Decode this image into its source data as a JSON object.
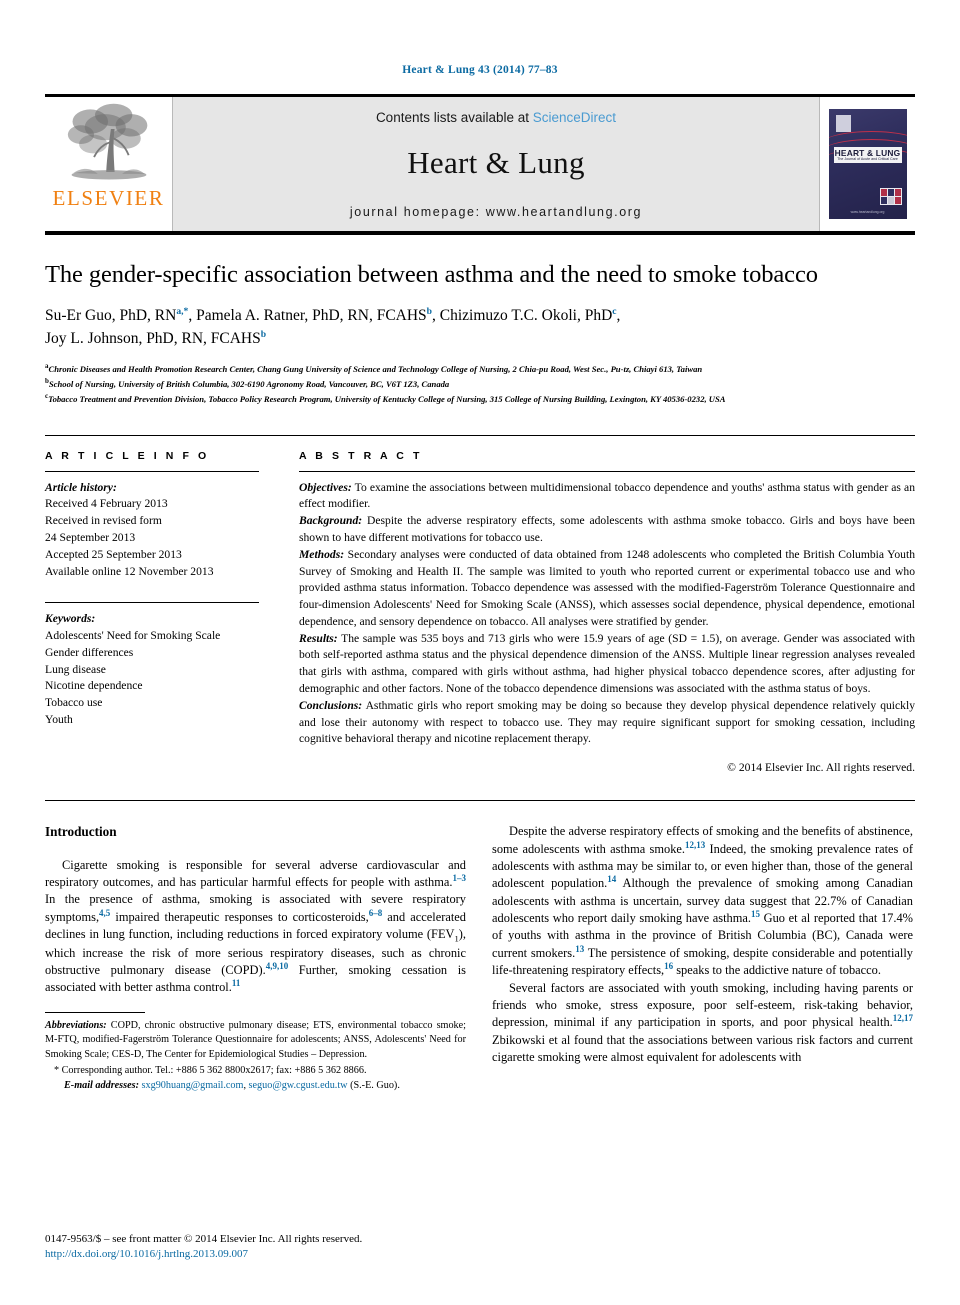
{
  "running_head": "Heart & Lung 43 (2014) 77–83",
  "masthead": {
    "contents_prefix": "Contents lists available at ",
    "sciencedirect": "ScienceDirect",
    "journal_name": "Heart & Lung",
    "homepage": "journal homepage: www.heartandlung.org",
    "publisher_wordmark": "ELSEVIER",
    "cover": {
      "title": "HEART & LUNG",
      "subtitle": "The Journal of Acute and Critical Care",
      "url": "www.heartandlung.org"
    }
  },
  "article": {
    "title": "The gender-specific association between asthma and the need to smoke tobacco",
    "authors_line1_a": "Su-Er Guo, PhD, RN",
    "authors_sup1": "a,*",
    "authors_line1_b": ", Pamela A. Ratner, PhD, RN, FCAHS",
    "authors_sup2": "b",
    "authors_line1_c": ", Chizimuzo T.C. Okoli, PhD",
    "authors_sup3": "c",
    "authors_line1_d": ",",
    "authors_line2": "Joy L. Johnson, PhD, RN, FCAHS",
    "authors_sup4": "b",
    "affiliations": [
      {
        "marker": "a",
        "text": "Chronic Diseases and Health Promotion Research Center, Chang Gung University of Science and Technology College of Nursing, 2 Chia-pu Road, West Sec., Pu-tz, Chiayi 613, Taiwan"
      },
      {
        "marker": "b",
        "text": "School of Nursing, University of British Columbia, 302-6190 Agronomy Road, Vancouver, BC, V6T 1Z3, Canada"
      },
      {
        "marker": "c",
        "text": "Tobacco Treatment and Prevention Division, Tobacco Policy Research Program, University of Kentucky College of Nursing, 315 College of Nursing Building, Lexington, KY 40536-0232, USA"
      }
    ]
  },
  "article_info": {
    "heading": "A R T I C L E   I N F O",
    "history_label": "Article history:",
    "history": [
      "Received 4 February 2013",
      "Received in revised form",
      "24 September 2013",
      "Accepted 25 September 2013",
      "Available online 12 November 2013"
    ],
    "keywords_label": "Keywords:",
    "keywords": [
      "Adolescents' Need for Smoking Scale",
      "Gender differences",
      "Lung disease",
      "Nicotine dependence",
      "Tobacco use",
      "Youth"
    ]
  },
  "abstract": {
    "heading": "A B S T R A C T",
    "objectives_label": "Objectives:",
    "objectives_text": " To examine the associations between multidimensional tobacco dependence and youths' asthma status with gender as an effect modifier.",
    "background_label": "Background:",
    "background_text": " Despite the adverse respiratory effects, some adolescents with asthma smoke tobacco. Girls and boys have been shown to have different motivations for tobacco use.",
    "methods_label": "Methods:",
    "methods_text": " Secondary analyses were conducted of data obtained from 1248 adolescents who completed the British Columbia Youth Survey of Smoking and Health II. The sample was limited to youth who reported current or experimental tobacco use and who provided asthma status information. Tobacco dependence was assessed with the modified-Fagerström Tolerance Questionnaire and four-dimension Adolescents' Need for Smoking Scale (ANSS), which assesses social dependence, physical dependence, emotional dependence, and sensory dependence on tobacco. All analyses were stratified by gender.",
    "results_label": "Results:",
    "results_text": " The sample was 535 boys and 713 girls who were 15.9 years of age (SD = 1.5), on average. Gender was associated with both self-reported asthma status and the physical dependence dimension of the ANSS. Multiple linear regression analyses revealed that girls with asthma, compared with girls without asthma, had higher physical tobacco dependence scores, after adjusting for demographic and other factors. None of the tobacco dependence dimensions was associated with the asthma status of boys.",
    "conclusions_label": "Conclusions:",
    "conclusions_text": " Asthmatic girls who report smoking may be doing so because they develop physical dependence relatively quickly and lose their autonomy with respect to tobacco use. They may require significant support for smoking cessation, including cognitive behavioral therapy and nicotine replacement therapy.",
    "copyright": "© 2014 Elsevier Inc. All rights reserved."
  },
  "body": {
    "intro_heading": "Introduction",
    "left_p1_a": "Cigarette smoking is responsible for several adverse cardiovascular and respiratory outcomes, and has particular harmful effects for people with asthma.",
    "left_p1_cit1": "1–3",
    "left_p1_b": " In the presence of asthma, smoking is associated with severe respiratory symptoms,",
    "left_p1_cit2": "4,5",
    "left_p1_c": " impaired therapeutic responses to corticosteroids,",
    "left_p1_cit3": "6–8",
    "left_p1_d": " and accelerated declines in lung function, including reductions in forced expiratory volume (FEV",
    "left_p1_sub": "1",
    "left_p1_e": "), which increase the risk of more serious respiratory diseases, such as chronic obstructive pulmonary disease (COPD).",
    "left_p1_cit4": "4,9,10",
    "left_p1_f": " Further, smoking cessation is associated with better asthma control.",
    "left_p1_cit5": "11",
    "right_p1_a": "Despite the adverse respiratory effects of smoking and the benefits of abstinence, some adolescents with asthma smoke.",
    "right_p1_cit1": "12,13",
    "right_p1_b": " Indeed, the smoking prevalence rates of adolescents with asthma may be similar to, or even higher than, those of the general adolescent population.",
    "right_p1_cit2": "14",
    "right_p1_c": " Although the prevalence of smoking among Canadian adolescents with asthma is uncertain, survey data suggest that 22.7% of Canadian adolescents who report daily smoking have asthma.",
    "right_p1_cit3": "15",
    "right_p1_d": " Guo et al reported that 17.4% of youths with asthma in the province of British Columbia (BC), Canada were current smokers.",
    "right_p1_cit4": "13",
    "right_p1_e": " The persistence of smoking, despite considerable and potentially life-threatening respiratory effects,",
    "right_p1_cit5": "16",
    "right_p1_f": " speaks to the addictive nature of tobacco.",
    "right_p2_a": "Several factors are associated with youth smoking, including having parents or friends who smoke, stress exposure, poor self-esteem, risk-taking behavior, depression, minimal if any participation in sports, and poor physical health.",
    "right_p2_cit1": "12,17",
    "right_p2_b": " Zbikowski et al found that the associations between various risk factors and current cigarette smoking were almost equivalent for adolescents with"
  },
  "footnote": {
    "abbrev_label": "Abbreviations:",
    "abbrev_text": " COPD, chronic obstructive pulmonary disease; ETS, environmental tobacco smoke; M-FTQ, modified-Fagerström Tolerance Questionnaire for adolescents; ANSS, Adolescents' Need for Smoking Scale; CES-D, The Center for Epidemiological Studies – Depression.",
    "corresponding": "* Corresponding author. Tel.: +886 5 362 8800x2617; fax: +886 5 362 8866.",
    "email_label": "E-mail addresses:",
    "email1": "sxg90huang@gmail.com",
    "email_sep": ", ",
    "email2": "seguo@gw.cgust.edu.tw",
    "email_suffix": " (S.-E. Guo)."
  },
  "footer": {
    "issn_line": "0147-9563/$ – see front matter © 2014 Elsevier Inc. All rights reserved.",
    "doi": "http://dx.doi.org/10.1016/j.hrtlng.2013.09.007"
  },
  "colors": {
    "link_blue": "#0b6aa2",
    "sciencedirect_blue": "#4a9bd1",
    "elsevier_orange": "#f08012"
  }
}
